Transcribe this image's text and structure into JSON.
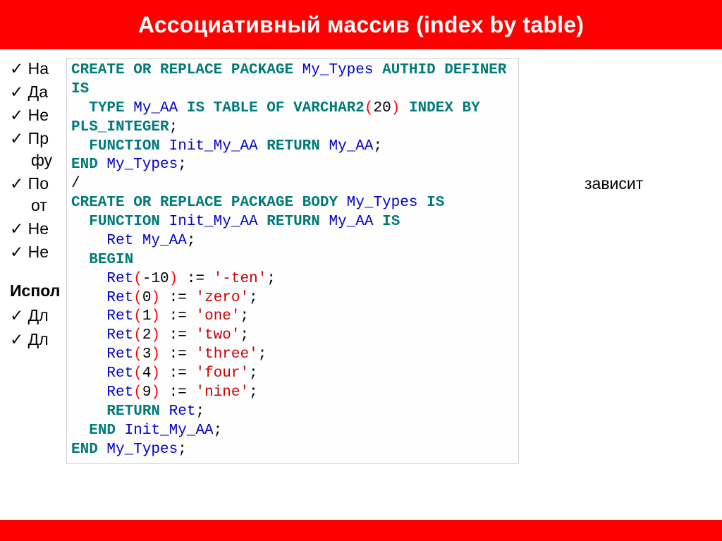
{
  "title": "Ассоциативный массив (index by table)",
  "bullets_top": [
    "На",
    "Да",
    "Не",
    "Пр",
    "По",
    "Не",
    "Не"
  ],
  "bullets_top_extra": {
    "3_line2": "фу",
    "4_line2": "от",
    "4_trailing": "зависит"
  },
  "use_heading": "Испол",
  "bullets_use": [
    "Дл",
    "Дл"
  ],
  "code": {
    "l01_kw": "CREATE OR REPLACE PACKAGE ",
    "l01_id": "My_Types",
    "l01_kw2": " AUTHID DEFINER",
    "l02_kw": "IS",
    "l03_kw1": "  TYPE ",
    "l03_id1": "My_AA",
    "l03_kw2": " IS TABLE OF VARCHAR2",
    "l03_par": "(",
    "l03_num": "20",
    "l03_par2": ")",
    "l03_kw3": " INDEX BY",
    "l04_kw": "PLS_INTEGER",
    "l04_semi": ";",
    "l05_kw1": "  FUNCTION ",
    "l05_id1": "Init_My_AA",
    "l05_kw2": " RETURN ",
    "l05_id2": "My_AA",
    "l05_semi": ";",
    "l06_kw": "END ",
    "l06_id": "My_Types",
    "l06_semi": ";",
    "l07": "/",
    "l08_kw": "CREATE OR REPLACE PACKAGE BODY ",
    "l08_id": "My_Types",
    "l08_kw2": " IS",
    "l09_kw1": "  FUNCTION ",
    "l09_id1": "Init_My_AA",
    "l09_kw2": " RETURN ",
    "l09_id2": "My_AA",
    "l09_kw3": " IS",
    "l10_pad": "    ",
    "l10_id1": "Ret",
    "l10_sp": " ",
    "l10_id2": "My_AA",
    "l10_semi": ";",
    "l11_pad": "  ",
    "l11_kw": "BEGIN",
    "assign": [
      {
        "idx": "-10",
        "val": "'-ten'"
      },
      {
        "idx": "0",
        "val": "'zero'"
      },
      {
        "idx": "1",
        "val": "'one'"
      },
      {
        "idx": "2",
        "val": "'two'"
      },
      {
        "idx": "3",
        "val": "'three'"
      },
      {
        "idx": "4",
        "val": "'four'"
      },
      {
        "idx": "9",
        "val": "'nine'"
      }
    ],
    "ret_kw": "RETURN ",
    "ret_id": "Ret",
    "end1_kw": "END ",
    "end1_id": "Init_My_AA",
    "end2_kw": "END ",
    "end2_id": "My_Types"
  }
}
